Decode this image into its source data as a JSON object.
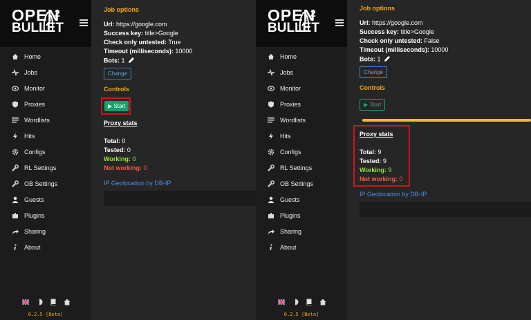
{
  "app": {
    "logo_open": "OPEN",
    "logo_bullet": "BULLET",
    "logo_sup": "2",
    "version": "0.2.5 [Beta]"
  },
  "nav": [
    {
      "label": "Home",
      "icon": "home-icon"
    },
    {
      "label": "Jobs",
      "icon": "pulse-icon"
    },
    {
      "label": "Monitor",
      "icon": "eye-icon"
    },
    {
      "label": "Proxies",
      "icon": "shield-icon"
    },
    {
      "label": "Wordlists",
      "icon": "list-icon"
    },
    {
      "label": "Hits",
      "icon": "bolt-icon"
    },
    {
      "label": "Configs",
      "icon": "gear-icon"
    },
    {
      "label": "RL Settings",
      "icon": "wrench-icon"
    },
    {
      "label": "OB Settings",
      "icon": "wrench-icon"
    },
    {
      "label": "Guests",
      "icon": "user-icon"
    },
    {
      "label": "Plugins",
      "icon": "puzzle-icon"
    },
    {
      "label": "Sharing",
      "icon": "share-icon"
    },
    {
      "label": "About",
      "icon": "info-icon"
    }
  ],
  "footer_icons": [
    "flag-uk-icon",
    "theme-icon",
    "book-icon",
    "house-icon"
  ],
  "job": {
    "title": "Job options",
    "url_label": "Url:",
    "url_value": "https://google.com",
    "success_label": "Success key:",
    "success_value": "title>Google",
    "check_label": "Check only untested:",
    "timeout_label": "Timeout (milliseconds):",
    "timeout_value": "10000",
    "bots_label": "Bots:",
    "bots_value": "1",
    "change_label": "Change"
  },
  "controls": {
    "title": "Controls",
    "start_label": "Start"
  },
  "proxy_stats": {
    "title": "Proxy stats",
    "total_label": "Total:",
    "tested_label": "Tested:",
    "working_label": "Working:",
    "not_working_label": "Not working:"
  },
  "geo_link": "IP Geolocation by DB-IP",
  "left_state": {
    "check_value": "True",
    "total": "0",
    "tested": "0",
    "working": "0",
    "not_working": "0"
  },
  "right_state": {
    "check_value": "False",
    "total": "9",
    "tested": "9",
    "working": "9",
    "not_working": "0",
    "progress": 1.0
  },
  "colors": {
    "accent": "#f2a814",
    "start_green": "#11a36a",
    "highlight_red": "#d2141e",
    "working_green": "#96e83a",
    "not_working_red": "#ff5b43",
    "link_blue": "#4d8fe8"
  }
}
